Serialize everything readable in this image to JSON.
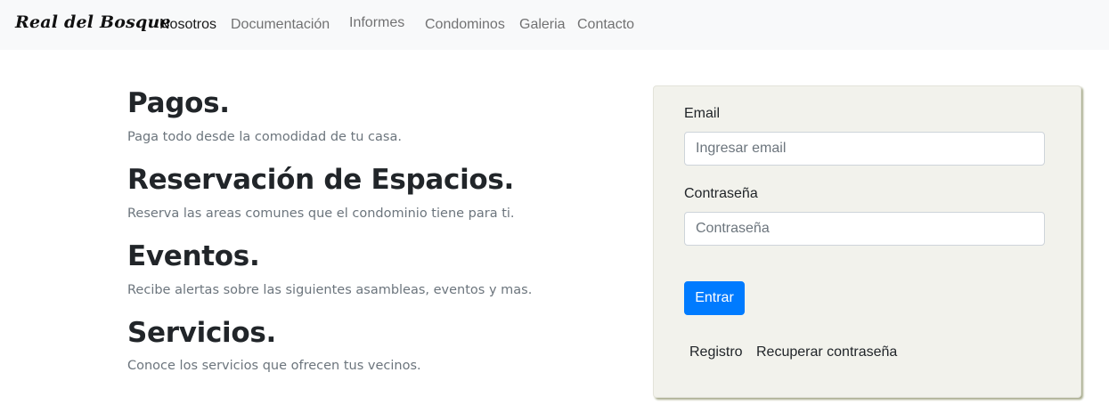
{
  "navbar": {
    "brand": "Real del Bosque",
    "links": [
      {
        "label": "Nosotros",
        "active": true
      },
      {
        "label": "Documentación",
        "active": false
      },
      {
        "label": "Informes",
        "active": false
      },
      {
        "label": "Condominos",
        "active": false
      },
      {
        "label": "Galeria",
        "active": false
      },
      {
        "label": "Contacto",
        "active": false
      }
    ]
  },
  "features": [
    {
      "title": "Pagos.",
      "description": "Paga todo desde la comodidad de tu casa."
    },
    {
      "title": "Reservación de Espacios.",
      "description": "Reserva las areas comunes que el condominio tiene para ti."
    },
    {
      "title": "Eventos.",
      "description": "Recibe alertas sobre las siguientes asambleas, eventos y mas."
    },
    {
      "title": "Servicios.",
      "description": "Conoce los servicios que ofrecen tus vecinos."
    }
  ],
  "login": {
    "email_label": "Email",
    "email_placeholder": "Ingresar email",
    "email_value": "",
    "password_label": "Contraseña",
    "password_placeholder": "Contraseña",
    "password_value": "",
    "submit_label": "Entrar",
    "register_link": "Registro",
    "recover_link": "Recuperar contraseña"
  },
  "colors": {
    "navbar_bg": "#f8f9fa",
    "card_bg": "#f2f2ec",
    "primary": "#007bff",
    "muted_text": "#6c757d"
  }
}
